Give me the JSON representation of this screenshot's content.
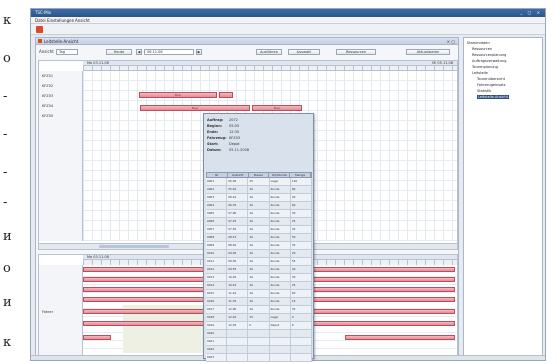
{
  "margin_text": {
    "letters": [
      "к",
      "о",
      "-",
      "-",
      "-",
      "-",
      "и",
      "о",
      "и",
      "к"
    ]
  },
  "window": {
    "title": "TSC-Mix",
    "controls": "_ □ ×"
  },
  "menu": {
    "items": [
      "Datei",
      "Einstellungen",
      "Ansicht"
    ]
  },
  "panel": {
    "title": "Leitstelle-Ansicht",
    "filter": {
      "label": "Ansicht",
      "view_value": "Tag",
      "date_value": "06.11.08",
      "buttons": [
        "Heute",
        "Ausführen",
        "Auswahl",
        "Ressourcen",
        "Aktualisieren"
      ]
    }
  },
  "gantt": {
    "header_left": "Mo 03.11.08",
    "header_right": "Mi 05.11.08",
    "rows": [
      "KFZ01",
      "KFZ02",
      "KFZ03",
      "KFZ04",
      "KFZ05"
    ],
    "bars": [
      {
        "label": "Tour"
      },
      {
        "label": ""
      },
      {
        "label": "Tour"
      },
      {
        "label": "Tour"
      }
    ]
  },
  "resource_gantt": {
    "header_left": "Mo 03.11.08",
    "row_label": "Fahrer"
  },
  "popup": {
    "info": [
      {
        "key": "Auftrag:",
        "value": "2072"
      },
      {
        "key": "Beginn:",
        "value": "05:05"
      },
      {
        "key": "Ende:",
        "value": "12:35"
      },
      {
        "key": "Fahrzeug:",
        "value": "KFZ03"
      },
      {
        "key": "Start:",
        "value": "Depot"
      },
      {
        "key": "Datum:",
        "value": "05.11.2008"
      }
    ],
    "columns": [
      "Nr",
      "Ankunft",
      "Dauer",
      "Ort/Kunde",
      "Menge"
    ],
    "rows": [
      [
        "0001",
        "05:05",
        "15",
        "Lager",
        "120"
      ],
      [
        "0002",
        "05:40",
        "10",
        "Kunde",
        "80"
      ],
      [
        "0003",
        "06:10",
        "10",
        "Kunde",
        "40"
      ],
      [
        "0004",
        "06:35",
        "10",
        "Kunde",
        "60"
      ],
      [
        "0005",
        "07:00",
        "10",
        "Kunde",
        "30"
      ],
      [
        "0006",
        "07:25",
        "10",
        "Kunde",
        "25"
      ],
      [
        "0007",
        "07:50",
        "10",
        "Kunde",
        "45"
      ],
      [
        "0008",
        "08:15",
        "10",
        "Kunde",
        "50"
      ],
      [
        "0009",
        "08:40",
        "10",
        "Kunde",
        "35"
      ],
      [
        "0010",
        "09:05",
        "10",
        "Kunde",
        "20"
      ],
      [
        "0011",
        "09:30",
        "10",
        "Kunde",
        "55"
      ],
      [
        "0012",
        "09:55",
        "10",
        "Kunde",
        "40"
      ],
      [
        "0013",
        "10:20",
        "10",
        "Kunde",
        "30"
      ],
      [
        "0014",
        "10:45",
        "10",
        "Kunde",
        "25"
      ],
      [
        "0015",
        "11:10",
        "10",
        "Kunde",
        "60"
      ],
      [
        "0016",
        "11:35",
        "10",
        "Kunde",
        "15"
      ],
      [
        "0017",
        "12:00",
        "10",
        "Kunde",
        "35"
      ],
      [
        "0018",
        "12:20",
        "15",
        "Lager",
        "0"
      ],
      [
        "0019",
        "12:35",
        "0",
        "Depot",
        "0"
      ],
      [
        "0020",
        "",
        "",
        "",
        ""
      ],
      [
        "0021",
        "",
        "",
        "",
        ""
      ],
      [
        "0022",
        "",
        "",
        "",
        ""
      ],
      [
        "0023",
        "",
        "",
        "",
        ""
      ]
    ]
  },
  "tree": {
    "items": [
      {
        "label": "Stammdaten",
        "level": 0
      },
      {
        "label": "Ressourcen",
        "level": 1
      },
      {
        "label": "Ressourcenplanung",
        "level": 1
      },
      {
        "label": "Auftragsverwaltung",
        "level": 1
      },
      {
        "label": "Tourenplanung",
        "level": 1
      },
      {
        "label": "Leitstelle",
        "level": 1
      },
      {
        "label": "Tourenübersicht",
        "level": 2
      },
      {
        "label": "Fahrzeugeinsatz",
        "level": 2
      },
      {
        "label": "Statistik",
        "level": 2
      },
      {
        "label": "Leitstelle-Ansicht",
        "level": 2,
        "selected": true
      }
    ]
  },
  "colors": {
    "accent": "#2a548a",
    "bar": "#e58a95",
    "selection": "#2f4d7a"
  }
}
